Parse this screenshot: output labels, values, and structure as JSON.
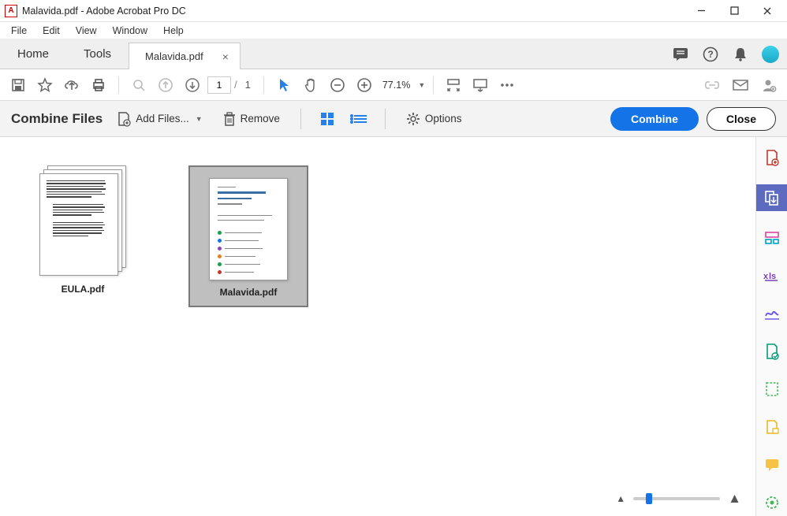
{
  "window": {
    "title": "Malavida.pdf - Adobe Acrobat Pro DC"
  },
  "menu": {
    "file": "File",
    "edit": "Edit",
    "view": "View",
    "window": "Window",
    "help": "Help"
  },
  "tabs": {
    "home": "Home",
    "tools": "Tools",
    "document": "Malavida.pdf",
    "close_glyph": "×"
  },
  "toolbar": {
    "page_current": "1",
    "page_sep": "/",
    "page_total": "1",
    "zoom_text": "77.1%"
  },
  "combine": {
    "title": "Combine Files",
    "add_files": "Add Files...",
    "remove": "Remove",
    "options": "Options",
    "combine_btn": "Combine",
    "close_btn": "Close"
  },
  "files": [
    {
      "name": "EULA.pdf",
      "selected": false
    },
    {
      "name": "Malavida.pdf",
      "selected": true
    }
  ]
}
